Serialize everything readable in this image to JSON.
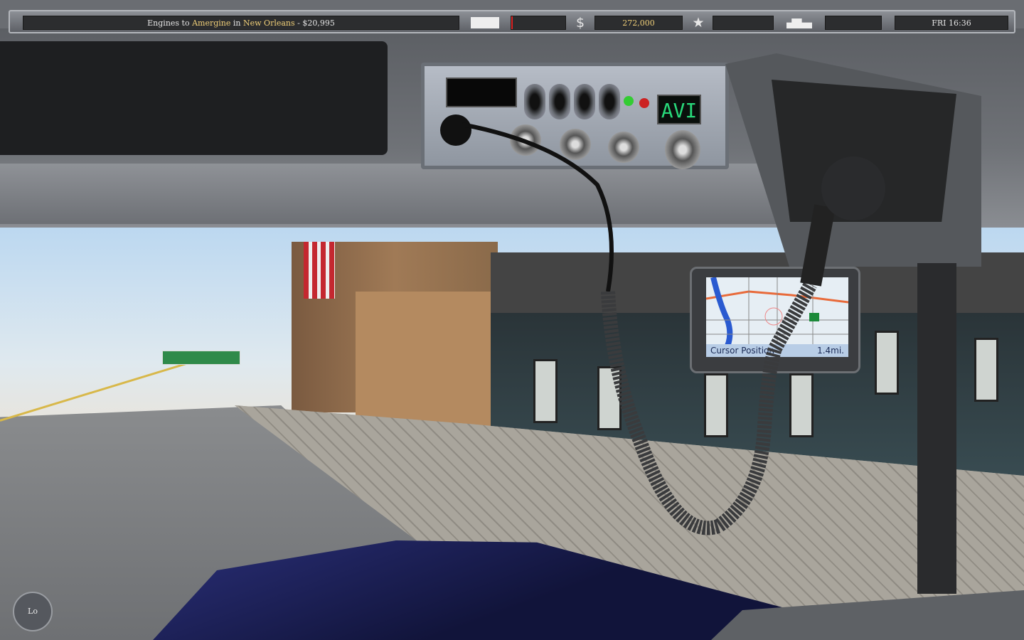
{
  "hud": {
    "job_prefix": "Engines to ",
    "job_company": "Amergine",
    "job_in": " in ",
    "job_city": "New Orleans",
    "job_pay": " - $20,995",
    "money_icon": "$",
    "money": "272,000",
    "rating_icon": "star-icon",
    "truck_icon": "truck-icon",
    "trailer_icon": "trailer-icon",
    "clock": "FRI 16:36",
    "damage_fill_percent": 2,
    "accent_color": "#f0cf78"
  },
  "cb_radio": {
    "display": "AVI"
  },
  "gps": {
    "status_label": "Cursor Position",
    "distance": "1.4mi."
  },
  "controls": {
    "lo_button": "Lo"
  }
}
